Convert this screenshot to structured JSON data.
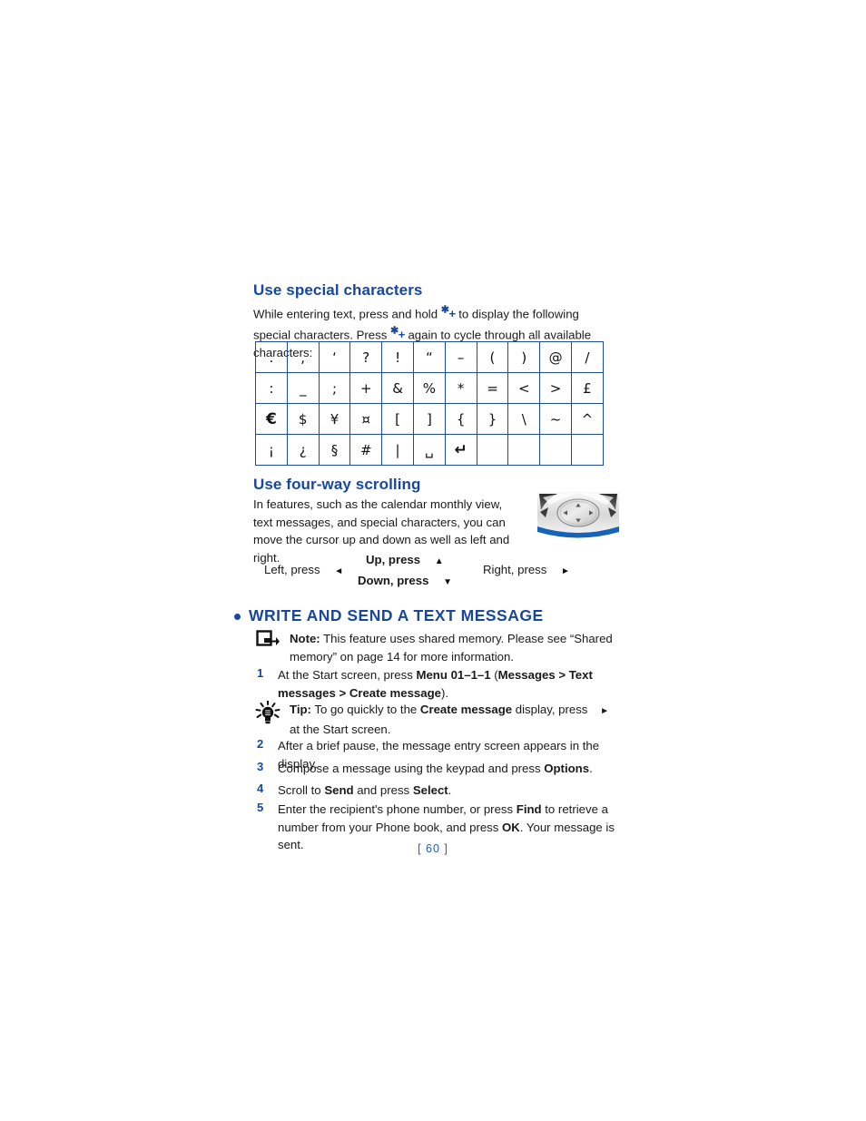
{
  "colors": {
    "heading_blue": "#17479E",
    "table_border": "#1C4B9B",
    "page_number_blue": "#2A5CAA",
    "body_text": "#1a1a1a"
  },
  "sections": {
    "special_characters": {
      "heading": "Use special characters",
      "paragraph_part1": "While entering text, press and hold ",
      "key_symbol": "*+",
      "paragraph_part2": " to display the following special characters. Press ",
      "paragraph_part3": " again to cycle through all available characters:"
    },
    "four_way_scrolling": {
      "heading": "Use four-way scrolling",
      "paragraph": "In features, such as the calendar monthly view, text messages, and special characters, you can move the cursor up and down as well as left and right.",
      "labels": {
        "left": "Left, press",
        "left_arrow": "◄",
        "up": "Up, press",
        "up_arrow": "▲",
        "down": "Down, press",
        "down_arrow": "▼",
        "right": "Right, press",
        "right_arrow": "►"
      },
      "image_alt": "navigation-key-photo"
    },
    "write_send_text": {
      "bullet": "•",
      "heading": "WRITE AND SEND A TEXT MESSAGE",
      "note": {
        "label": "Note:",
        "text": " This feature uses shared memory. Please see “Shared memory” on page 14 for more information."
      },
      "tip": {
        "label": "Tip:",
        "text_part1": " To go quickly to the ",
        "bold1": "Create message",
        "text_part2": " display, press ",
        "arrow": "►",
        "text_part3": " at the Start screen."
      },
      "steps": [
        {
          "num": "1",
          "segments": [
            {
              "t": "At the Start screen, press ",
              "b": false
            },
            {
              "t": "Menu 01–1–1",
              "b": true
            },
            {
              "t": " (",
              "b": false
            },
            {
              "t": "Messages > Text messages > Create message",
              "b": true
            },
            {
              "t": ").",
              "b": false
            }
          ]
        },
        {
          "num": "2",
          "segments": [
            {
              "t": "After a brief pause, the message entry screen appears in the display.",
              "b": false
            }
          ]
        },
        {
          "num": "3",
          "segments": [
            {
              "t": "Compose a message using the keypad and press ",
              "b": false
            },
            {
              "t": "Options",
              "b": true
            },
            {
              "t": ".",
              "b": false
            }
          ]
        },
        {
          "num": "4",
          "segments": [
            {
              "t": "Scroll to ",
              "b": false
            },
            {
              "t": "Send",
              "b": true
            },
            {
              "t": " and press ",
              "b": false
            },
            {
              "t": "Select",
              "b": true
            },
            {
              "t": ".",
              "b": false
            }
          ]
        },
        {
          "num": "5",
          "segments": [
            {
              "t": "Enter the recipient's phone number, or press ",
              "b": false
            },
            {
              "t": "Find",
              "b": true
            },
            {
              "t": " to retrieve a number from your Phone book, and press ",
              "b": false
            },
            {
              "t": "OK",
              "b": true
            },
            {
              "t": ". Your message is sent.",
              "b": false
            }
          ]
        }
      ]
    }
  },
  "character_table": {
    "rows": [
      [
        ".",
        ",",
        "‘",
        "?",
        "!",
        "“",
        "–",
        "(",
        ")",
        "@",
        "/"
      ],
      [
        ":",
        "_",
        ";",
        "+",
        "&",
        "%",
        "*",
        "=",
        "<",
        ">",
        "£"
      ],
      [
        "€",
        "$",
        "¥",
        "¤",
        "[",
        "]",
        "{",
        "}",
        "\\",
        "~",
        "^"
      ],
      [
        "¡",
        "¿",
        "§",
        "#",
        "|",
        "␣",
        "↵",
        "",
        "",
        "",
        ""
      ]
    ]
  },
  "footer": {
    "page_number": "[ 60 ]"
  }
}
